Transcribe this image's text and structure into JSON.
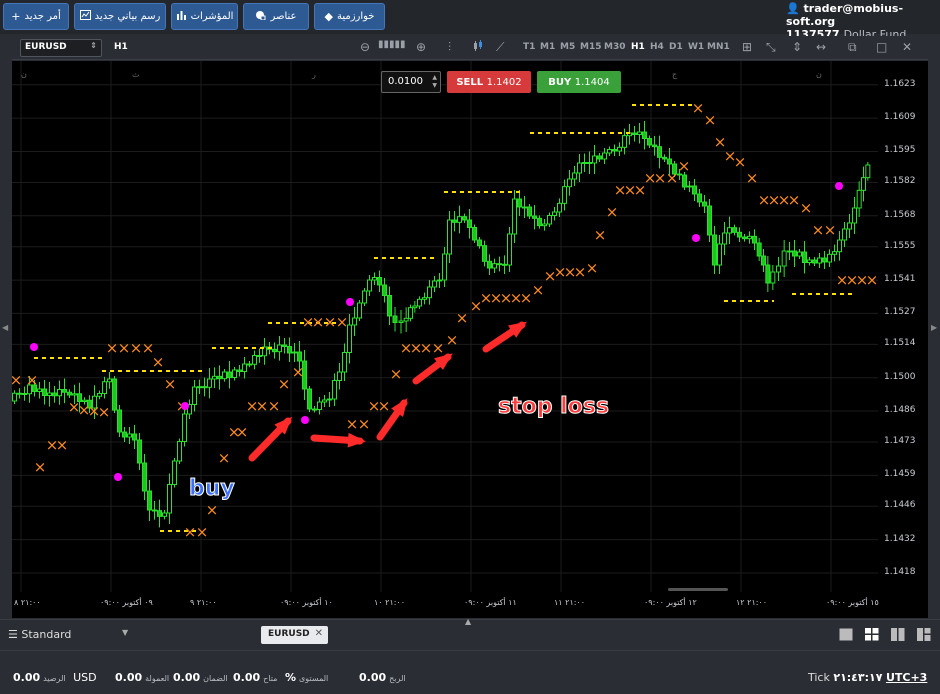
{
  "toolbar": {
    "new_order": "أمر جديد",
    "new_chart": "رسم بياني جديد",
    "indicators": "المؤشرات",
    "elements": "عناصر",
    "algorithms": "خوارزمية"
  },
  "account": {
    "email": "trader@mobius-soft.org",
    "number": "1137577",
    "fund": "Dollar Fund"
  },
  "chart_toolbar": {
    "symbol": "EURUSD",
    "timeframe_label": "H1",
    "timeframes": [
      "T1",
      "M1",
      "M5",
      "M15",
      "M30",
      "H1",
      "H4",
      "D1",
      "W1",
      "MN1"
    ],
    "active_timeframe": "H1"
  },
  "trade_panel": {
    "lot": "0.0100",
    "sell_label": "SELL",
    "sell_price": "1.1402",
    "buy_label": "BUY",
    "buy_price": "1.1404"
  },
  "chart_data": {
    "type": "candlestick",
    "y_ticks": [
      "1.1623",
      "1.1609",
      "1.1595",
      "1.1582",
      "1.1568",
      "1.1555",
      "1.1541",
      "1.1527",
      "1.1514",
      "1.1500",
      "1.1486",
      "1.1473",
      "1.1459",
      "1.1446",
      "1.1432",
      "1.1418"
    ],
    "x_ticks": [
      "٢١:٠٠ ٨",
      "٠٩ أكتوبر ٠٩:٠٠",
      "٢١:٠٠ ٩",
      "١٠ أكتوبر ٠٩:٠٠",
      "٢١:٠٠ ١٠",
      "١١ أكتوبر ٠٩:٠٠",
      "٢١:٠٠ ١١",
      "١٢ أكتوبر ٠٩:٠٠",
      "٢١:٠٠ ١٢",
      "١٥ أكتوبر ٠٩:٠٠"
    ],
    "ylim": [
      1.141,
      1.1633
    ],
    "colors": {
      "up": "#22cc22",
      "down": "#22cc22",
      "sar": "#ff8c1a",
      "level": "#ffe000",
      "dot": "#ff00ff"
    }
  },
  "annotations": {
    "buy": "buy",
    "stop_loss": "stop loss"
  },
  "tabs": {
    "layout": "Standard",
    "symbol_tab": "EURUSD"
  },
  "status": {
    "balance_val": "0.00",
    "balance_currency": "USD",
    "balance_lbl": "الرصيد",
    "commission_val": "0.00",
    "commission_lbl": "العمولة",
    "margin_val": "0.00",
    "margin_lbl": "الضمان",
    "free_val": "0.00",
    "free_lbl": "متاح",
    "level_val": "%",
    "level_lbl": "المستوى",
    "profit_val": "0.00",
    "profit_lbl": "الربح",
    "tick_label": "Tick",
    "time": "٢١:٤٣:١٧",
    "timezone": "UTC+3"
  }
}
